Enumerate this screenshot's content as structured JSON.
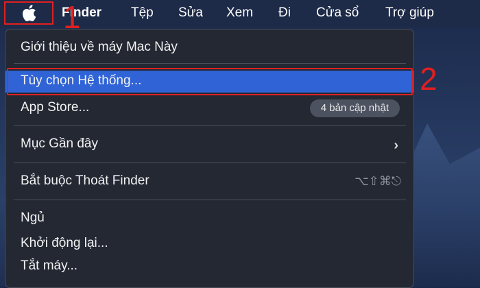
{
  "menubar": {
    "items": [
      "Finder",
      "Tệp",
      "Sửa",
      "Xem",
      "Đi",
      "Cửa sổ",
      "Trợ giúp"
    ]
  },
  "annotations": {
    "step1": "1",
    "step2": "2"
  },
  "dropdown": {
    "about": "Giới thiệu về máy Mac Này",
    "system_prefs": "Tùy chọn Hệ thống...",
    "app_store": "App Store...",
    "app_store_badge": "4 bản cập nhật",
    "recent_items": "Mục Gần đây",
    "force_quit": "Bắt buộc Thoát Finder",
    "force_quit_shortcut": "⌥⇧⌘⎋",
    "sleep": "Ngủ",
    "restart": "Khởi động lại...",
    "shutdown": "Tắt máy..."
  },
  "colors": {
    "highlight": "#2f63d6",
    "annotation_red": "#e02020",
    "menu_bg": "#232833"
  }
}
